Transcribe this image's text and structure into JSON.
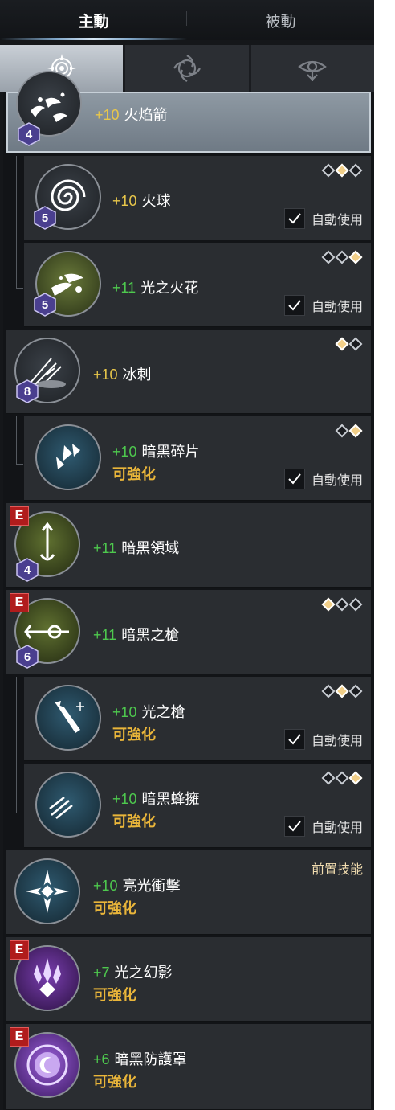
{
  "tabs": {
    "active": "主動",
    "passive": "被動"
  },
  "categories": [
    {
      "icon": "sun-crest-icon",
      "active": true
    },
    {
      "icon": "spiral-crest-icon",
      "active": false
    },
    {
      "icon": "eye-crest-icon",
      "active": false
    }
  ],
  "colors": {
    "level_green": "#4ec94e",
    "level_yellow": "#e9c74a",
    "enhance": "#e9b53a",
    "e_badge": "#b01c1c",
    "diamond_on": "#f2cf88",
    "selected_row": "#8e99a3"
  },
  "auto_use_label": "自動使用",
  "prereq_label": "前置技能",
  "enhance_label": "可強化",
  "skills": [
    {
      "id": "fire-arrow",
      "plus": "+10",
      "plus_color": "yellow",
      "name": "火焰箭",
      "level": "4",
      "e": false,
      "selected": true,
      "icon": "fire-arrow-icon"
    },
    {
      "id": "fireball",
      "plus": "+10",
      "plus_color": "yellow",
      "name": "火球",
      "level": "5",
      "e": false,
      "diamonds": [
        false,
        true,
        false
      ],
      "auto": true,
      "icon": "fireball-icon"
    },
    {
      "id": "light-spark",
      "plus": "+11",
      "plus_color": "green",
      "name": "光之火花",
      "level": "5",
      "e": false,
      "diamonds": [
        false,
        false,
        true
      ],
      "auto": true,
      "icon": "light-spark-icon"
    },
    {
      "id": "ice-spike",
      "plus": "+10",
      "plus_color": "yellow",
      "name": "冰刺",
      "level": "8",
      "e": false,
      "diamonds": [
        true,
        false
      ],
      "icon": "ice-spike-icon"
    },
    {
      "id": "dark-shard",
      "plus": "+10",
      "plus_color": "green",
      "name": "暗黑碎片",
      "e": false,
      "diamonds": [
        false,
        true
      ],
      "auto": true,
      "enhance": true,
      "icon": "dark-shard-icon"
    },
    {
      "id": "dark-domain",
      "plus": "+11",
      "plus_color": "green",
      "name": "暗黑領域",
      "level": "4",
      "e": true,
      "icon": "dark-domain-icon"
    },
    {
      "id": "dark-spear",
      "plus": "+11",
      "plus_color": "green",
      "name": "暗黑之槍",
      "level": "6",
      "e": true,
      "diamonds": [
        true,
        false,
        false
      ],
      "icon": "dark-spear-icon"
    },
    {
      "id": "light-spear",
      "plus": "+10",
      "plus_color": "green",
      "name": "光之槍",
      "e": false,
      "diamonds": [
        false,
        true,
        false
      ],
      "auto": true,
      "enhance": true,
      "icon": "light-spear-icon"
    },
    {
      "id": "dark-swarm",
      "plus": "+10",
      "plus_color": "green",
      "name": "暗黑蜂擁",
      "e": false,
      "diamonds": [
        false,
        false,
        true
      ],
      "auto": true,
      "enhance": true,
      "icon": "dark-swarm-icon"
    },
    {
      "id": "bright-strike",
      "plus": "+10",
      "plus_color": "green",
      "name": "亮光衝擊",
      "e": false,
      "prereq": true,
      "enhance": true,
      "icon": "bright-strike-icon"
    },
    {
      "id": "light-phantom",
      "plus": "+7",
      "plus_color": "green",
      "name": "光之幻影",
      "e": true,
      "enhance": true,
      "icon": "light-phantom-icon"
    },
    {
      "id": "dark-shield",
      "plus": "+6",
      "plus_color": "green",
      "name": "暗黑防護罩",
      "e": true,
      "enhance": true,
      "icon": "dark-shield-icon"
    }
  ]
}
